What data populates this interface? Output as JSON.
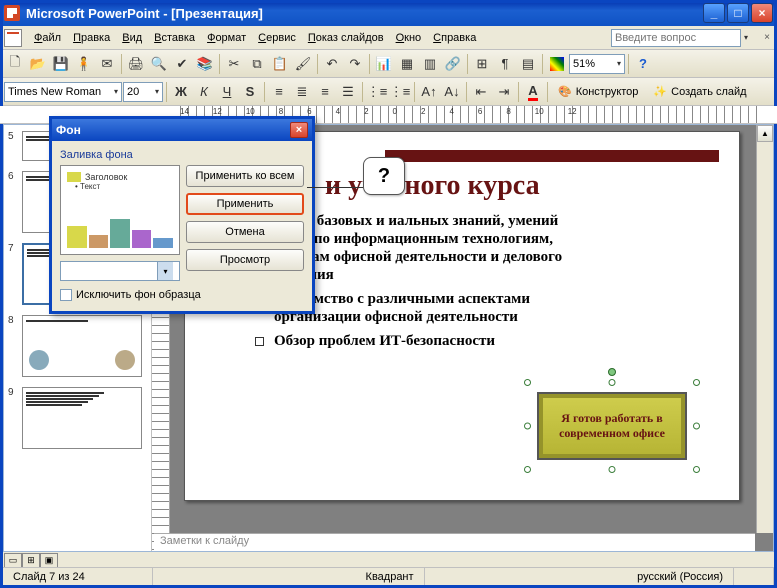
{
  "titlebar": {
    "text": "Microsoft PowerPoint - [Презентация]"
  },
  "menu": {
    "items": [
      "Файл",
      "Правка",
      "Вид",
      "Вставка",
      "Формат",
      "Сервис",
      "Показ слайдов",
      "Окно",
      "Справка"
    ],
    "ask_placeholder": "Введите вопрос"
  },
  "toolbar1": {
    "zoom": "51%"
  },
  "toolbar2": {
    "font": "Times New Roman",
    "size": "20",
    "designer": "Конструктор",
    "newslide": "Создать слайд"
  },
  "ruler": [
    "14",
    "12",
    "10",
    "8",
    "6",
    "4",
    "2",
    "0",
    "2",
    "4",
    "6",
    "8",
    "10",
    "12"
  ],
  "thumbs": {
    "start": 5,
    "count": 5
  },
  "slide": {
    "title_suffix": "и учебного курса",
    "bullets": [
      "чение базовых и иальных знаний, умений и ков по информационным технологиям, основам офисной деятельности и делового общения",
      "Знакомство с различными аспектами организации офисной деятельности",
      "Обзор проблем ИТ-безопасности"
    ],
    "callout": "Я готов работать в современном офисе"
  },
  "notes": {
    "placeholder": "Заметки к слайду"
  },
  "status": {
    "slide": "Слайд 7 из 24",
    "template": "Квадрант",
    "lang": "русский (Россия)"
  },
  "dialog": {
    "title": "Фон",
    "fill_label": "Заливка фона",
    "preview_title": "Заголовок",
    "preview_text": "Текст",
    "apply_all": "Применить ко всем",
    "apply": "Применить",
    "cancel": "Отмена",
    "preview_btn": "Просмотр",
    "exclude": "Исключить фон образца"
  },
  "tooltip": {
    "q": "?"
  }
}
